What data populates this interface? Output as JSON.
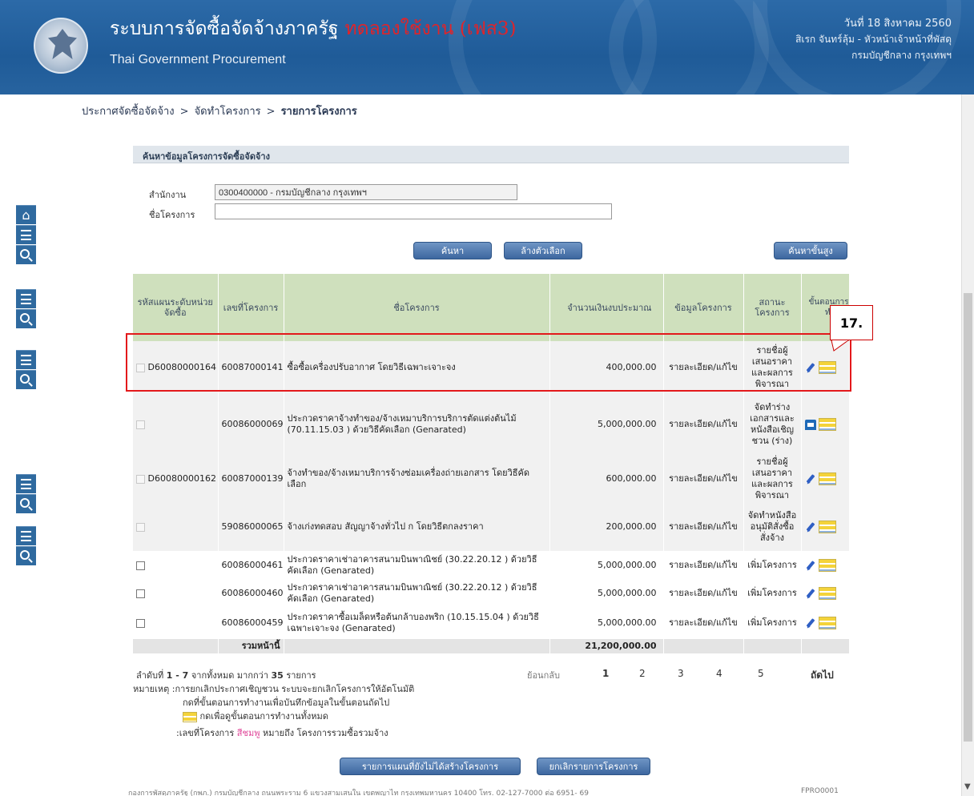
{
  "header": {
    "title": "ระบบการจัดซื้อจัดจ้างภาครัฐ",
    "trial_label": "ทดลองใช้งาน (เฟส3)",
    "subtitle": "Thai Government Procurement",
    "date": "วันที่ 18 สิงหาคม 2560",
    "user": "สิเรก จันทร์ลุ้ม - หัวหน้าเจ้าหน้าที่พัสดุ",
    "dept": "กรมบัญชีกลาง กรุงเทพฯ"
  },
  "breadcrumb": {
    "item1": "ประกาศจัดซื้อจัดจ้าง",
    "item2": "จัดทำโครงการ",
    "item3": "รายการโครงการ",
    "sep": ">"
  },
  "search": {
    "title": "ค้นหาข้อมูลโครงการจัดซื้อจัดจ้าง",
    "dept_label": "สำนักงาน",
    "dept_value": "0300400000 - กรมบัญชีกลาง กรุงเทพฯ",
    "project_label": "ชื่อโครงการ",
    "project_value": "",
    "search_button": "ค้นหา",
    "clear_button": "ล้างตัวเลือก",
    "advanced_button": "ค้นหาขั้นสูง"
  },
  "table": {
    "headers": {
      "plan_code": "รหัสแผนระดับหน่วยจัดซื้อ",
      "project_no": "เลขที่โครงการ",
      "project_name": "ชื่อโครงการ",
      "budget": "จำนวนเงินงบประมาณ",
      "info": "ข้อมูลโครงการ",
      "status": "สถานะโครงการ",
      "step": "ขั้นตอนการทำงาน"
    },
    "rows": [
      {
        "plan": "D60080000164",
        "no": "60087000141",
        "name": "ซื้อซื้อเครื่องปรับอากาศ โดยวิธีเฉพาะเจาะจง",
        "amount": "400,000.00",
        "link": "รายละเอียด/แก้ไข",
        "status": "รายชื่อผู้เสนอราคาและผลการพิจารณา",
        "icon": "pen"
      },
      {
        "plan": "",
        "no": "60086000069",
        "name": "ประกวดราคาจ้างทำของ/จ้างเหมาบริการบริการตัดแต่งต้นไม้ (70.11.15.03 ) ด้วยวิธีคัดเลือก (Genarated)",
        "amount": "5,000,000.00",
        "link": "รายละเอียด/แก้ไข",
        "status": "จัดทำร่างเอกสารและหนังสือเชิญชวน (ร่าง)",
        "icon": "doc"
      },
      {
        "plan": "D60080000162",
        "no": "60087000139",
        "name": "จ้างทำของ/จ้างเหมาบริการจ้างซ่อมเครื่องถ่ายเอกสาร โดยวิธีคัดเลือก",
        "amount": "600,000.00",
        "link": "รายละเอียด/แก้ไข",
        "status": "รายชื่อผู้เสนอราคาและผลการพิจารณา",
        "icon": "pen"
      },
      {
        "plan": "",
        "no": "59086000065",
        "name": "จ้างเก่งทดสอบ สัญญาจ้างทั่วไป ก โดยวิธีตกลงราคา",
        "amount": "200,000.00",
        "link": "รายละเอียด/แก้ไข",
        "status": "จัดทำหนังสืออนุมัติสั่งซื้อสั่งจ้าง",
        "icon": "pen"
      },
      {
        "plan": "",
        "no": "60086000461",
        "name": "ประกวดราคาเช่าอาคารสนามบินพาณิชย์ (30.22.20.12 ) ด้วยวิธีคัดเลือก (Genarated)",
        "amount": "5,000,000.00",
        "link": "รายละเอียด/แก้ไข",
        "status": "เพิ่มโครงการ",
        "icon": "pen"
      },
      {
        "plan": "",
        "no": "60086000460",
        "name": "ประกวดราคาเช่าอาคารสนามบินพาณิชย์ (30.22.20.12 ) ด้วยวิธีคัดเลือก (Genarated)",
        "amount": "5,000,000.00",
        "link": "รายละเอียด/แก้ไข",
        "status": "เพิ่มโครงการ",
        "icon": "pen"
      },
      {
        "plan": "",
        "no": "60086000459",
        "name": "ประกวดราคาซื้อเมล็ดหรือต้นกล้าบองพริก (10.15.15.04 ) ด้วยวิธีเฉพาะเจาะจง (Genarated)",
        "amount": "5,000,000.00",
        "link": "รายละเอียด/แก้ไข",
        "status": "เพิ่มโครงการ",
        "icon": "pen"
      }
    ],
    "sum_label": "รวมหน้านี้",
    "sum_value": "21,200,000.00"
  },
  "pager": {
    "summary_prefix": "ลำดับที่",
    "range": "1 - 7",
    "summary_mid": "จากทั้งหมด มากกว่า",
    "total": "35",
    "summary_suffix": "รายการ",
    "back": "ย้อนกลับ",
    "p1": "1",
    "p2": "2",
    "p3": "3",
    "p4": "4",
    "p5": "5",
    "next": "ถัดไป"
  },
  "notes": {
    "line1": "หมายเหตุ :การยกเลิกประกาศเชิญชวน ระบบจะยกเลิกโครงการให้อัตโนมัติ",
    "line2": "กดที่ขั้นตอนการทำงานเพื่อบันทึกข้อมูลในขั้นตอนถัดไป",
    "line3": "กดเพื่อดูขั้นตอนการทำงานทั้งหมด",
    "line4_prefix": ":เลขที่โครงการ",
    "line4_pink": "สีชมพู",
    "line4_suffix": "หมายถึง โครงการรวมซื้อรวมจ้าง"
  },
  "bottom_buttons": {
    "plan_list": "รายการแผนที่ยังไม่ได้สร้างโครงการ",
    "cancel_list": "ยกเลิกรายการโครงการ"
  },
  "callout": "17.",
  "footer": {
    "address": "กองการพัสดุภาครัฐ (กพภ.) กรมบัญชีกลาง ถนนพระราม 6 แขวงสามเสนใน เขตพญาไท กรุงเทพมหานคร 10400 โทร. 02-127-7000 ต่อ 6951- 69",
    "code": "FPRO0001"
  },
  "colors": {
    "header_bg": "#1f5b98",
    "trial_red": "#e0242a",
    "table_header_bg": "#cfe0bd",
    "highlight_red": "#e3191b"
  }
}
